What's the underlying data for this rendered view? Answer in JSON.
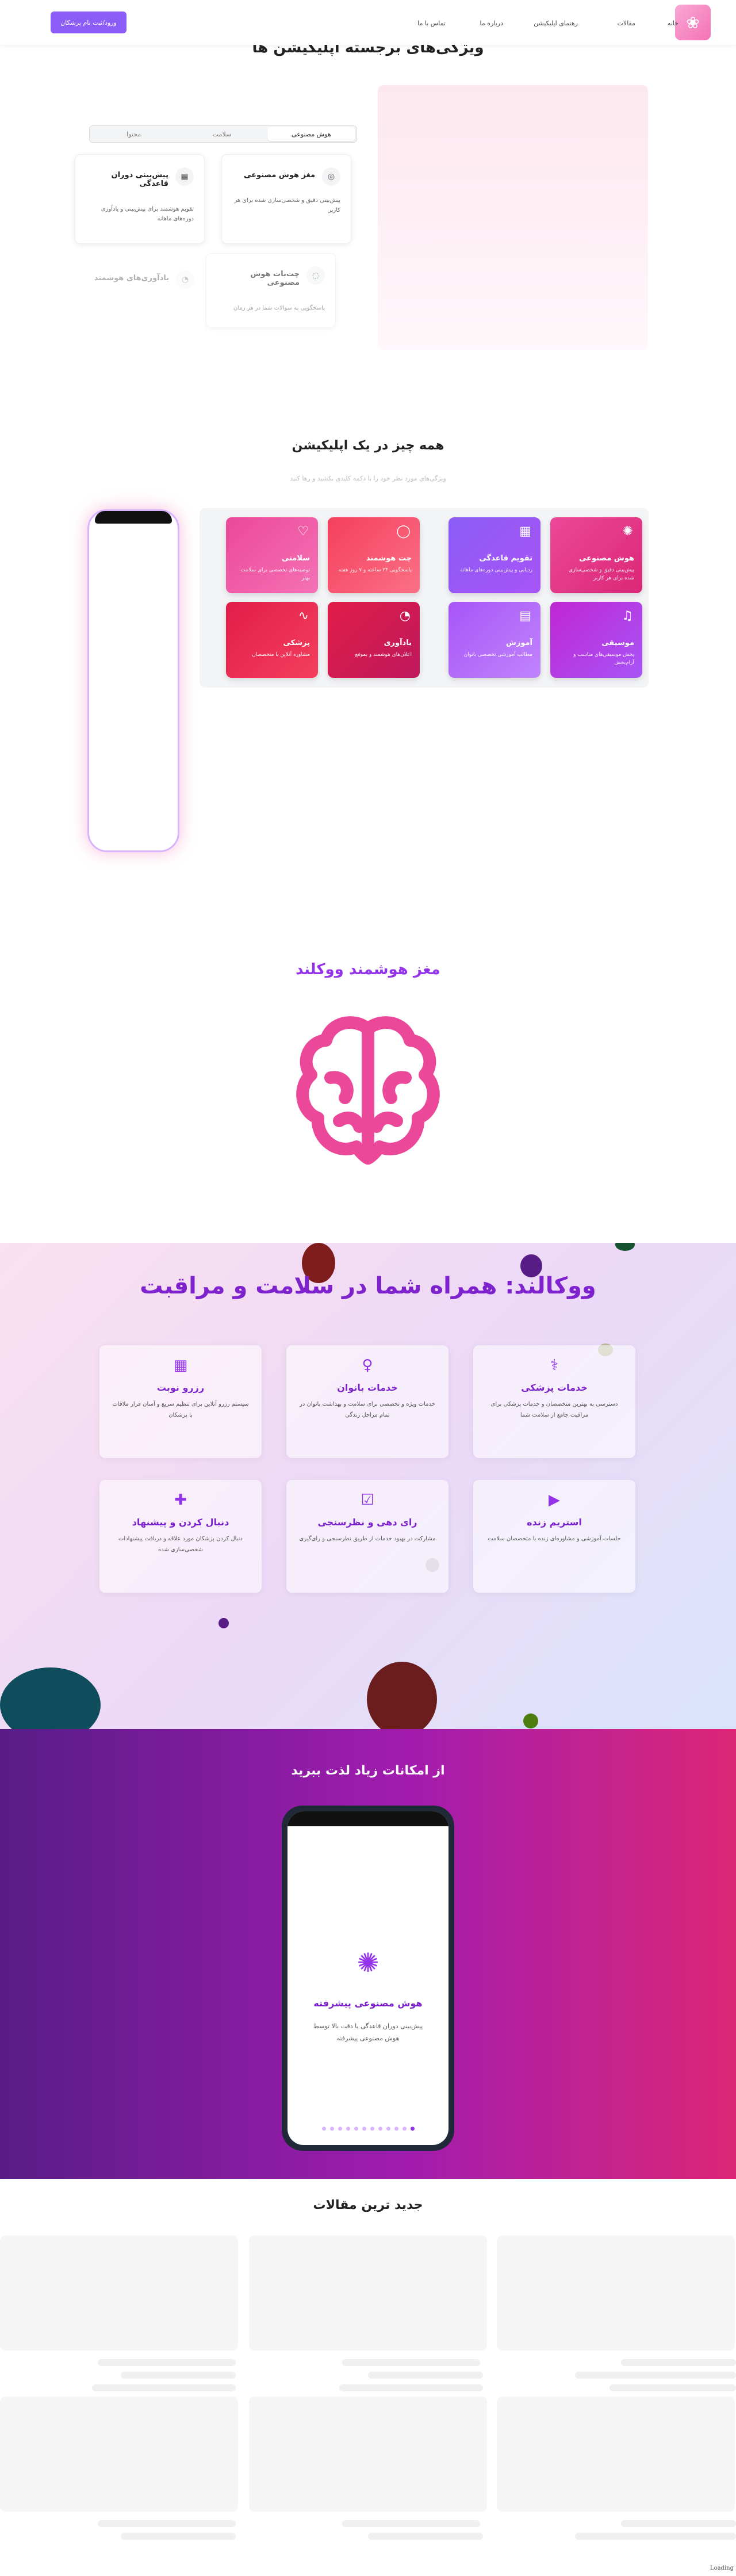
{
  "header": {
    "nav": [
      "خانه",
      "مقالات",
      "رهنمای اپلیکیشن",
      "درباره ما",
      "تماس با ما"
    ],
    "cta": "ورود/ثبت نام پزشکان"
  },
  "features": {
    "title": "ویژگی‌های برجسته اپلیکیشن ها",
    "tabs": [
      "هوش مصنوعی",
      "سلامت",
      "محتوا"
    ],
    "cards": [
      {
        "title": "مغز هوش مصنوعی",
        "desc": "پیش‌بینی دقیق و شخصی‌سازی شده برای هر کاربر",
        "icon": "brain-icon"
      },
      {
        "title": "پیش‌بینی دوران قاعدگی",
        "desc": "تقویم هوشمند برای پیش‌بینی و یادآوری دوره‌های ماهانه",
        "icon": "calendar-icon"
      },
      {
        "title": "چت‌بات هوش مصنوعی",
        "desc": "پاسخگویی به سوالات شما در هر زمان",
        "icon": "chat-icon"
      },
      {
        "title": "یادآوری‌های هوشمند",
        "desc": "",
        "icon": "bell-icon"
      }
    ]
  },
  "all_in_one": {
    "title": "همه چیز در یک اپلیکیشن",
    "subtitle": "ویژگی‌های مورد نظر خود را با دکمه کلیدی بکشید و رها کنید",
    "cards": [
      {
        "title": "هوش مصنوعی",
        "desc": "پیش‌بینی دقیق و شخصی‌سازی شده برای هر کاربر",
        "icon": "brain-icon",
        "color": "#ec4899"
      },
      {
        "title": "تقویم قاعدگی",
        "desc": "ردیابی و پیش‌بینی دوره‌های ماهانه",
        "icon": "calendar-icon",
        "color": "#8b5cf6"
      },
      {
        "title": "چت هوشمند",
        "desc": "پاسخگویی ۲۴ ساعته و ۷ روز هفته",
        "icon": "chat-icon",
        "color": "#f43f5e"
      },
      {
        "title": "سلامتی",
        "desc": "توصیه‌های تخصصی برای سلامت بهتر",
        "icon": "heart-icon",
        "color": "#ec4899"
      },
      {
        "title": "موسیقی",
        "desc": "پخش موسیقی‌های مناسب و آرام‌بخش",
        "icon": "music-icon",
        "color": "#c026d3"
      },
      {
        "title": "آموزش",
        "desc": "مطالب آموزشی تخصصی بانوان",
        "icon": "book-icon",
        "color": "#a855f7"
      },
      {
        "title": "یادآوری",
        "desc": "اعلان‌های هوشمند و بموقع",
        "icon": "bell-icon",
        "color": "#e11d48"
      },
      {
        "title": "پزشکی",
        "desc": "مشاوره آنلاین با متخصصان",
        "icon": "pulse-icon",
        "color": "#e11d48"
      }
    ]
  },
  "brain": {
    "title": "مغز هوشمند ووکلند"
  },
  "services": {
    "title": "ووکالند: همراه شما در سلامت و مراقبت",
    "cards": [
      {
        "title": "خدمات پزشکی",
        "desc": "دسترسی به بهترین متخصصان و خدمات پزشکی برای مراقبت جامع از سلامت شما",
        "icon": "doctor-icon"
      },
      {
        "title": "خدمات بانوان",
        "desc": "خدمات ویژه و تخصصی برای سلامت و بهداشت بانوان در تمام مراحل زندگی",
        "icon": "woman-icon"
      },
      {
        "title": "رزرو نوبت",
        "desc": "سیستم رزرو آنلاین برای تنظیم سریع و آسان قرار ملاقات با پزشکان",
        "icon": "calendar-check-icon"
      },
      {
        "title": "استریم زنده",
        "desc": "جلسات آموزشی و مشاوره‌ای زنده با متخصصان سلامت",
        "icon": "video-icon"
      },
      {
        "title": "رای دهی و نظرسنجی",
        "desc": "مشارکت در بهبود خدمات از طریق نظرسنجی و رای‌گیری",
        "icon": "vote-icon"
      },
      {
        "title": "دنبال کردن و پیشنهاد",
        "desc": "دنبال کردن پزشکان مورد علاقه و دریافت پیشنهادات شخصی‌سازی شده",
        "icon": "user-plus-icon"
      }
    ]
  },
  "enjoy": {
    "title": "از امکانات زیاد لذت ببرید",
    "slide_title": "هوش مصنوعی پیشرفته",
    "slide_desc": "پیش‌بینی دوران قاعدگی با دقت بالا توسط هوش مصنوعی پیشرفته",
    "slide_count": 12,
    "active_slide": 1
  },
  "articles": {
    "title": "جدید ترین مقالات"
  },
  "footer": {
    "loading": "Loading"
  },
  "colors": {
    "primary": "#8b5cf6",
    "pink": "#ec4899",
    "service_title": "#7e22ce"
  }
}
